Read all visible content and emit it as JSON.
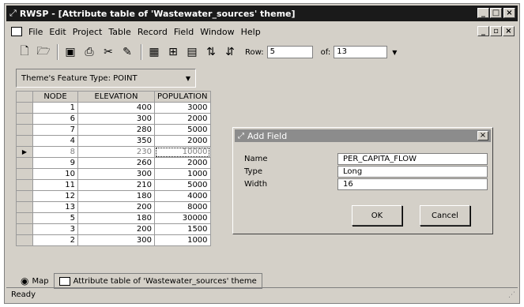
{
  "window": {
    "title": "RWSP - [Attribute table of 'Wastewater_sources' theme]",
    "app_icon": "rwsp-app-icon",
    "controls": {
      "minimize": "_",
      "maximize": "□",
      "close": "×"
    }
  },
  "menubar": {
    "items": [
      "File",
      "Edit",
      "Project",
      "Table",
      "Record",
      "Field",
      "Window",
      "Help"
    ],
    "doc_controls": {
      "minimize": "_",
      "restore": "▫",
      "close": "×"
    }
  },
  "toolbar": {
    "row_label": "Row:",
    "row_value": "5",
    "of_label": "of:",
    "of_value": "13"
  },
  "theme_bar": {
    "label": "Theme's Feature Type: POINT"
  },
  "table": {
    "columns": [
      "NODE",
      "ELEVATION",
      "POPULATION"
    ],
    "selected_row": 4,
    "rows": [
      [
        "1",
        "400",
        "3000"
      ],
      [
        "6",
        "300",
        "2000"
      ],
      [
        "7",
        "280",
        "5000"
      ],
      [
        "4",
        "350",
        "2000"
      ],
      [
        "8",
        "230",
        "10000"
      ],
      [
        "9",
        "260",
        "2000"
      ],
      [
        "10",
        "300",
        "1000"
      ],
      [
        "11",
        "210",
        "5000"
      ],
      [
        "12",
        "180",
        "4000"
      ],
      [
        "13",
        "200",
        "8000"
      ],
      [
        "5",
        "180",
        "30000"
      ],
      [
        "3",
        "200",
        "1500"
      ],
      [
        "2",
        "300",
        "1000"
      ]
    ]
  },
  "dialog": {
    "title": "Add Field",
    "close_label": "×",
    "name_label": "Name",
    "name_value": "PER_CAPITA_FLOW",
    "type_label": "Type",
    "type_value": "Long",
    "width_label": "Width",
    "width_value": "16",
    "ok_label": "OK",
    "cancel_label": "Cancel"
  },
  "tabs": {
    "map_label": "Map",
    "table_label": "Attribute table of 'Wastewater_sources' theme"
  },
  "status": {
    "text": "Ready"
  }
}
